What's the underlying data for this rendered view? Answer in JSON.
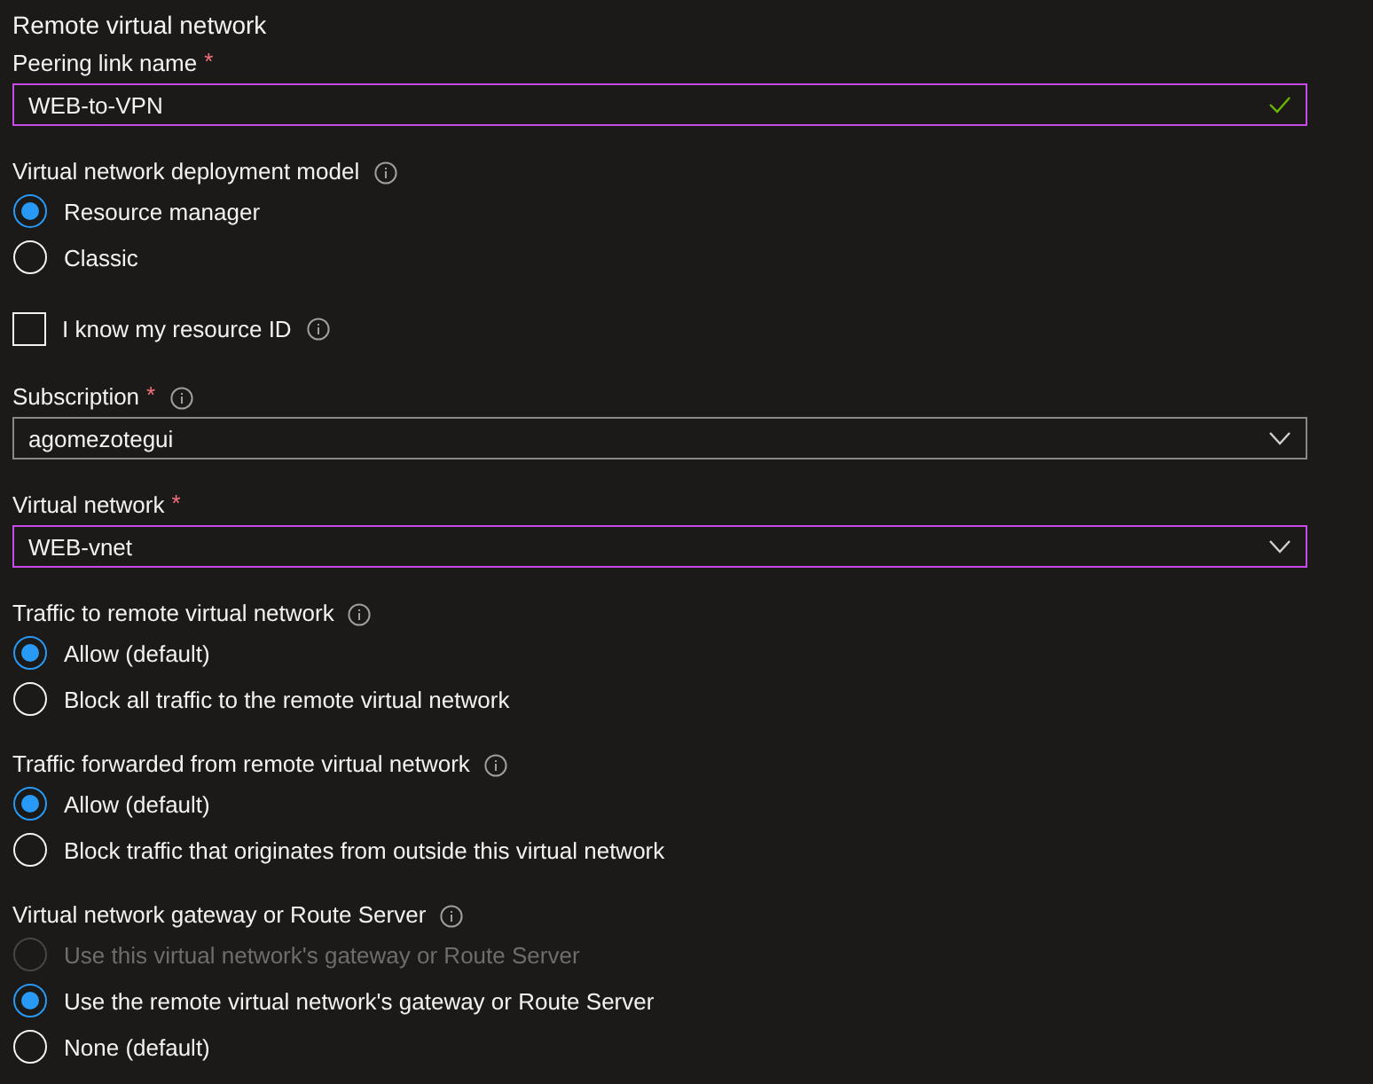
{
  "section_title": "Remote virtual network",
  "fields": [
    {
      "kind": "text",
      "label": "Peering link name",
      "required_mark": "*",
      "value": "WEB-to-VPN",
      "focused": true,
      "valid": true
    },
    {
      "kind": "radio",
      "label": "Virtual network deployment model",
      "info": true,
      "options": [
        {
          "label": "Resource manager",
          "selected": true,
          "disabled": false
        },
        {
          "label": "Classic",
          "selected": false,
          "disabled": false
        }
      ]
    },
    {
      "kind": "checkbox",
      "label": "I know my resource ID",
      "info": true,
      "checked": false
    },
    {
      "kind": "dropdown",
      "label": "Subscription",
      "required_mark": "*",
      "info": true,
      "value": "agomezotegui",
      "focused": false
    },
    {
      "kind": "dropdown",
      "label": "Virtual network",
      "required_mark": "*",
      "value": "WEB-vnet",
      "focused": true
    },
    {
      "kind": "radio",
      "label": "Traffic to remote virtual network",
      "info": true,
      "options": [
        {
          "label": "Allow (default)",
          "selected": true,
          "disabled": false
        },
        {
          "label": "Block all traffic to the remote virtual network",
          "selected": false,
          "disabled": false
        }
      ]
    },
    {
      "kind": "radio",
      "label": "Traffic forwarded from remote virtual network",
      "info": true,
      "options": [
        {
          "label": "Allow (default)",
          "selected": true,
          "disabled": false
        },
        {
          "label": "Block traffic that originates from outside this virtual network",
          "selected": false,
          "disabled": false
        }
      ]
    },
    {
      "kind": "radio",
      "label": "Virtual network gateway or Route Server",
      "info": true,
      "options": [
        {
          "label": "Use this virtual network's gateway or Route Server",
          "selected": false,
          "disabled": true
        },
        {
          "label": "Use the remote virtual network's gateway or Route Server",
          "selected": true,
          "disabled": false
        },
        {
          "label": "None (default)",
          "selected": false,
          "disabled": false
        }
      ]
    }
  ]
}
